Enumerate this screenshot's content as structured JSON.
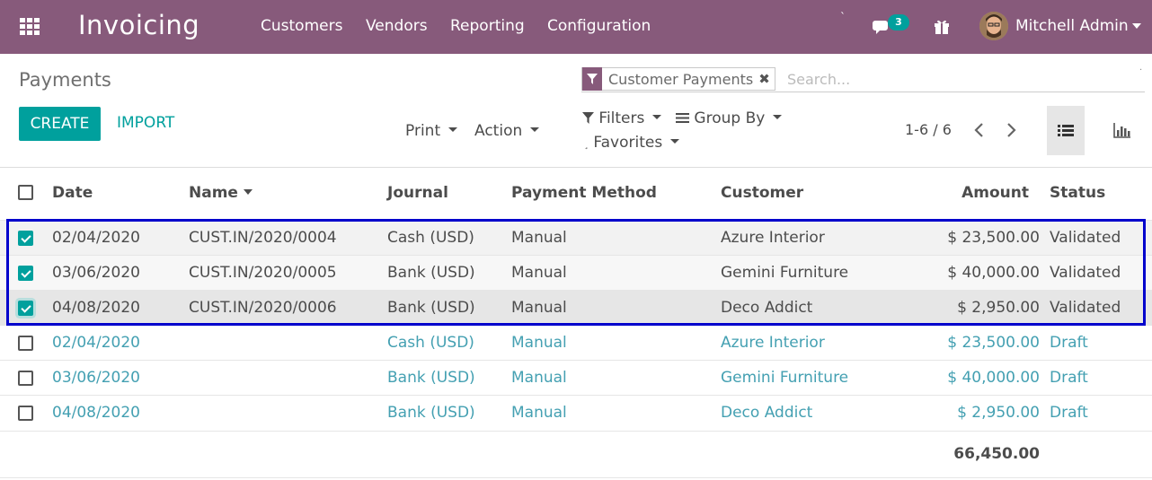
{
  "navbar": {
    "app_title": "Invoicing",
    "menus": [
      "Customers",
      "Vendors",
      "Reporting",
      "Configuration"
    ],
    "tick": "`",
    "chat_count": "3",
    "user_name": "Mitchell Admin",
    "bg_color": "#875a7b"
  },
  "control": {
    "breadcrumb": "Payments",
    "create_label": "CREATE",
    "import_label": "IMPORT",
    "print_label": "Print",
    "action_label": "Action",
    "filters_label": "Filters",
    "groupby_label": "Group By",
    "favorites_label": "Favorites",
    "pager_text": "1-6 / 6"
  },
  "search": {
    "facet_label": "Customer Payments",
    "placeholder": "Search..."
  },
  "table": {
    "columns": [
      "Date",
      "Name",
      "Journal",
      "Payment Method",
      "Customer",
      "Amount",
      "Status"
    ],
    "rows": [
      {
        "checked": true,
        "date": "02/04/2020",
        "name": "CUST.IN/2020/0004",
        "journal": "Cash (USD)",
        "method": "Manual",
        "customer": "Azure Interior",
        "amount": "$ 23,500.00",
        "status": "Validated"
      },
      {
        "checked": true,
        "date": "03/06/2020",
        "name": "CUST.IN/2020/0005",
        "journal": "Bank (USD)",
        "method": "Manual",
        "customer": "Gemini Furniture",
        "amount": "$ 40,000.00",
        "status": "Validated"
      },
      {
        "checked": true,
        "date": "04/08/2020",
        "name": "CUST.IN/2020/0006",
        "journal": "Bank (USD)",
        "method": "Manual",
        "customer": "Deco Addict",
        "amount": "$ 2,950.00",
        "status": "Validated"
      },
      {
        "checked": false,
        "date": "02/04/2020",
        "name": "",
        "journal": "Cash (USD)",
        "method": "Manual",
        "customer": "Azure Interior",
        "amount": "$ 23,500.00",
        "status": "Draft"
      },
      {
        "checked": false,
        "date": "03/06/2020",
        "name": "",
        "journal": "Bank (USD)",
        "method": "Manual",
        "customer": "Gemini Furniture",
        "amount": "$ 40,000.00",
        "status": "Draft"
      },
      {
        "checked": false,
        "date": "04/08/2020",
        "name": "",
        "journal": "Bank (USD)",
        "method": "Manual",
        "customer": "Deco Addict",
        "amount": "$ 2,950.00",
        "status": "Draft"
      }
    ],
    "total": "66,450.00"
  },
  "colors": {
    "primary": "#875a7b",
    "accent": "#00a09d",
    "draft_text": "#44a0b2",
    "selection_outline": "#0000cc"
  }
}
